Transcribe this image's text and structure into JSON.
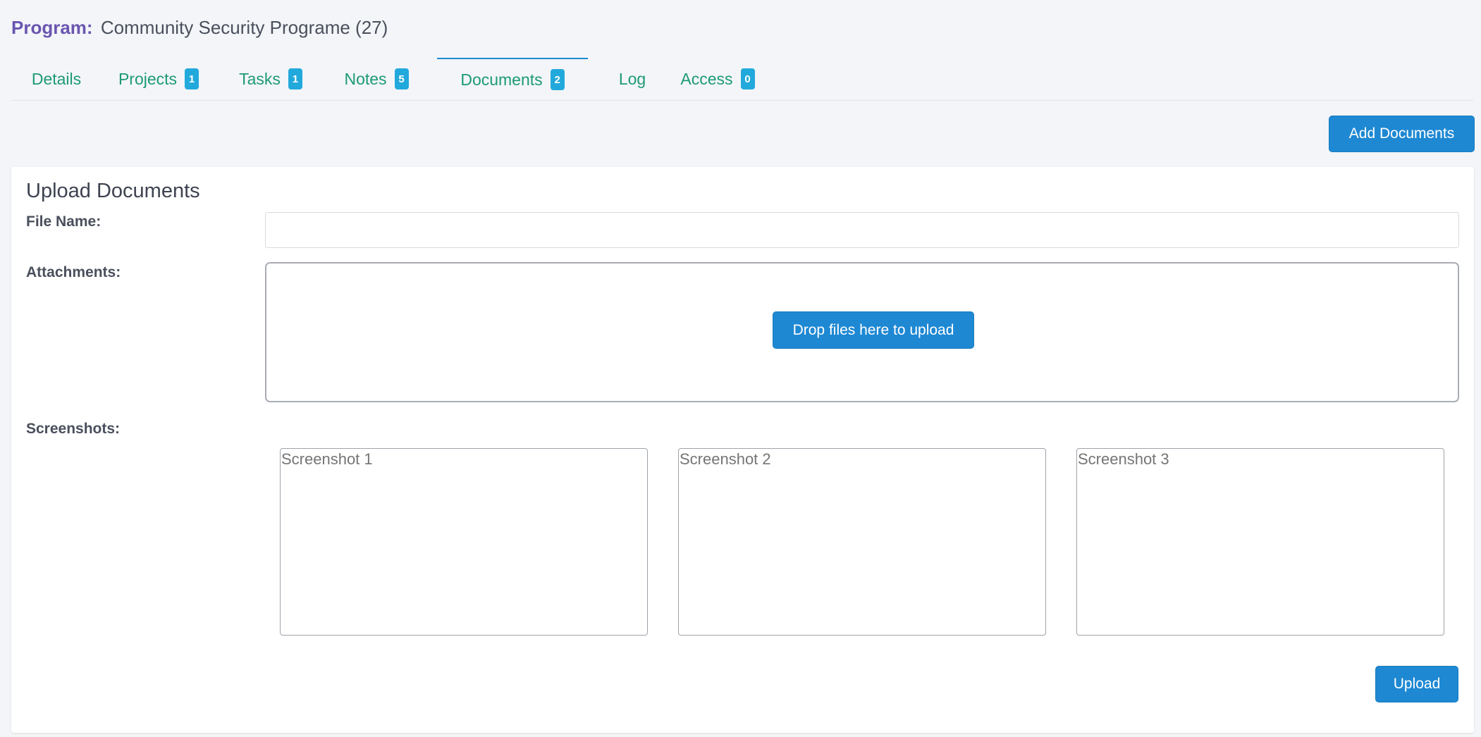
{
  "program": {
    "label": "Program:",
    "name": "Community Security Programe (27)"
  },
  "tabs": [
    {
      "label": "Details",
      "badge": null
    },
    {
      "label": "Projects",
      "badge": "1"
    },
    {
      "label": "Tasks",
      "badge": "1"
    },
    {
      "label": "Notes",
      "badge": "5"
    },
    {
      "label": "Documents",
      "badge": "2",
      "active": true
    },
    {
      "label": "Log",
      "badge": null
    },
    {
      "label": "Access",
      "badge": "0"
    }
  ],
  "toolbar": {
    "add_documents_label": "Add Documents"
  },
  "upload_form": {
    "title": "Upload Documents",
    "file_name_label": "File Name:",
    "file_name_value": "",
    "attachments_label": "Attachments:",
    "dropzone_button_label": "Drop files here to upload",
    "screenshots_label": "Screenshots:",
    "screenshots": [
      {
        "placeholder": "Screenshot 1"
      },
      {
        "placeholder": "Screenshot 2"
      },
      {
        "placeholder": "Screenshot 3"
      }
    ],
    "upload_label": "Upload"
  },
  "colors": {
    "accent": "#1e88d3",
    "tab_text": "#1d9a74",
    "badge": "#22a9dc",
    "program_label": "#6a55b0",
    "background": "#f3f5f8"
  }
}
